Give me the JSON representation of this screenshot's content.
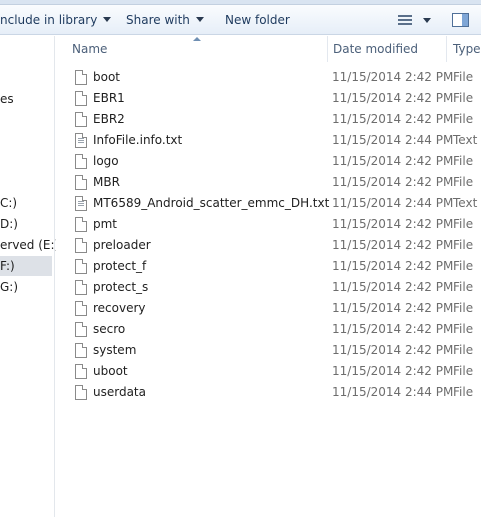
{
  "toolbar": {
    "include_in_library": "nclude in library",
    "share_with": "Share with",
    "new_folder": "New folder"
  },
  "nav": {
    "items": [
      "es",
      "C:)",
      "D:)",
      "erved (E:)",
      "F:)",
      "G:)"
    ],
    "selected_index": 4
  },
  "columns": {
    "name": "Name",
    "date_modified": "Date modified",
    "type": "Type"
  },
  "files": [
    {
      "name": "boot",
      "date": "11/15/2014 2:42 PM",
      "type": "File",
      "icon": "file-icon"
    },
    {
      "name": "EBR1",
      "date": "11/15/2014 2:42 PM",
      "type": "File",
      "icon": "file-icon"
    },
    {
      "name": "EBR2",
      "date": "11/15/2014 2:42 PM",
      "type": "File",
      "icon": "file-icon"
    },
    {
      "name": "InfoFile.info.txt",
      "date": "11/15/2014 2:44 PM",
      "type": "Text D",
      "icon": "text-file-icon"
    },
    {
      "name": "logo",
      "date": "11/15/2014 2:42 PM",
      "type": "File",
      "icon": "file-icon"
    },
    {
      "name": "MBR",
      "date": "11/15/2014 2:42 PM",
      "type": "File",
      "icon": "file-icon"
    },
    {
      "name": "MT6589_Android_scatter_emmc_DH.txt",
      "date": "11/15/2014 2:44 PM",
      "type": "Text D",
      "icon": "text-file-icon"
    },
    {
      "name": "pmt",
      "date": "11/15/2014 2:42 PM",
      "type": "File",
      "icon": "file-icon"
    },
    {
      "name": "preloader",
      "date": "11/15/2014 2:42 PM",
      "type": "File",
      "icon": "file-icon"
    },
    {
      "name": "protect_f",
      "date": "11/15/2014 2:42 PM",
      "type": "File",
      "icon": "file-icon"
    },
    {
      "name": "protect_s",
      "date": "11/15/2014 2:42 PM",
      "type": "File",
      "icon": "file-icon"
    },
    {
      "name": "recovery",
      "date": "11/15/2014 2:42 PM",
      "type": "File",
      "icon": "file-icon"
    },
    {
      "name": "secro",
      "date": "11/15/2014 2:42 PM",
      "type": "File",
      "icon": "file-icon"
    },
    {
      "name": "system",
      "date": "11/15/2014 2:42 PM",
      "type": "File",
      "icon": "file-icon"
    },
    {
      "name": "uboot",
      "date": "11/15/2014 2:42 PM",
      "type": "File",
      "icon": "file-icon"
    },
    {
      "name": "userdata",
      "date": "11/15/2014 2:44 PM",
      "type": "File",
      "icon": "file-icon"
    }
  ]
}
